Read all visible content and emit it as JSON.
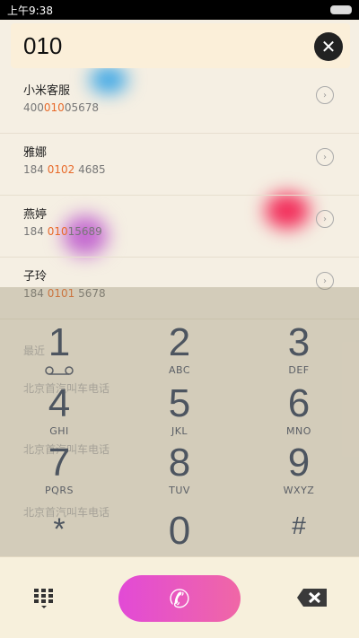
{
  "status": {
    "time": "上午9:38"
  },
  "search": {
    "number": "010"
  },
  "contacts": [
    {
      "name": "小米客服",
      "phone_pre": "400",
      "phone_hl": "010",
      "phone_post": "05678"
    },
    {
      "name": "雅娜",
      "phone_pre": "184 ",
      "phone_hl": "0102",
      "phone_post": " 4685"
    },
    {
      "name": "燕婷",
      "phone_pre": "184 ",
      "phone_hl": "010",
      "phone_post": "15689"
    },
    {
      "name": "子玲",
      "phone_pre": "184 ",
      "phone_hl": "0101",
      "phone_post": " 5678"
    }
  ],
  "faded": {
    "label": "最近",
    "item1": "北京首汽叫车电话",
    "item2": "北京首汽叫车电话",
    "item3": "北京首汽叫车电话"
  },
  "keys": [
    {
      "digit": "1",
      "letters": ""
    },
    {
      "digit": "2",
      "letters": "ABC"
    },
    {
      "digit": "3",
      "letters": "DEF"
    },
    {
      "digit": "4",
      "letters": "GHI"
    },
    {
      "digit": "5",
      "letters": "JKL"
    },
    {
      "digit": "6",
      "letters": "MNO"
    },
    {
      "digit": "7",
      "letters": "PQRS"
    },
    {
      "digit": "8",
      "letters": "TUV"
    },
    {
      "digit": "9",
      "letters": "WXYZ"
    },
    {
      "digit": "*",
      "letters": ""
    },
    {
      "digit": "0",
      "letters": ""
    },
    {
      "digit": "#",
      "letters": ""
    }
  ],
  "colors": {
    "call": "#e24ad6",
    "highlight": "#e86a2a"
  }
}
